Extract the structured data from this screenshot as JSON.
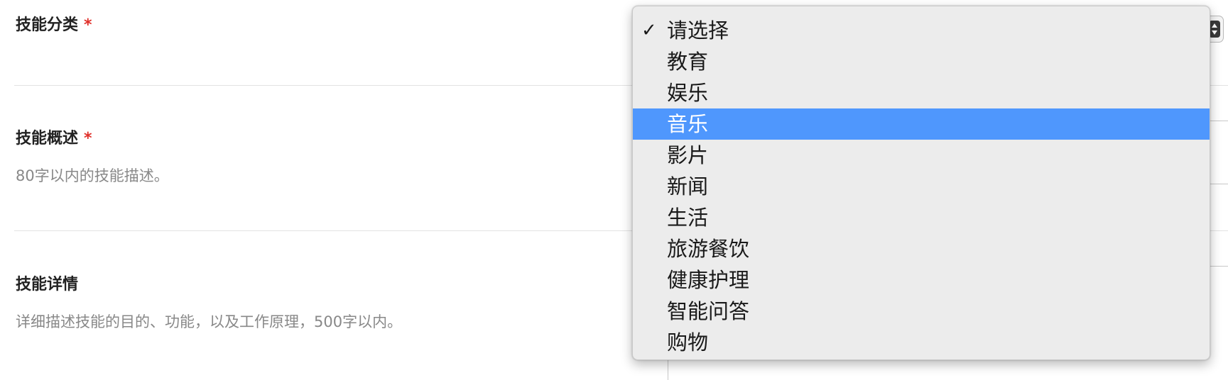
{
  "form": {
    "category": {
      "label": "技能分类",
      "required_mark": "*"
    },
    "summary": {
      "label": "技能概述",
      "required_mark": "*",
      "hint": "80字以内的技能描述。"
    },
    "details": {
      "label": "技能详情",
      "hint": "详细描述技能的目的、功能，以及工作原理，500字以内。"
    }
  },
  "dropdown": {
    "checkmark": "✓",
    "selected_index": 0,
    "highlighted_index": 3,
    "options": [
      "请选择",
      "教育",
      "娱乐",
      "音乐",
      "影片",
      "新闻",
      "生活",
      "旅游餐饮",
      "健康护理",
      "智能问答",
      "购物"
    ]
  },
  "colors": {
    "highlight": "#4f97fd",
    "required": "#e0302a",
    "hint_text": "#888888"
  }
}
